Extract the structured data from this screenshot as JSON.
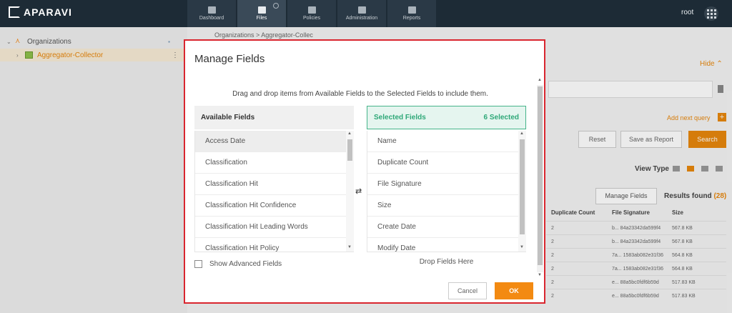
{
  "app": {
    "brand": "APARAVI",
    "user": "root"
  },
  "nav": [
    {
      "label": "Dashboard",
      "icon": "dashboard-icon"
    },
    {
      "label": "Files",
      "icon": "folder-icon"
    },
    {
      "label": "Policies",
      "icon": "gear-icon"
    },
    {
      "label": "Administration",
      "icon": "users-icon"
    },
    {
      "label": "Reports",
      "icon": "report-icon"
    }
  ],
  "sidebar": {
    "org_label": "Organizations",
    "collector_label": "Aggregator-Collector"
  },
  "background": {
    "breadcrumb": "Organizations  >  Aggregator-Collec",
    "hide_label": "Hide",
    "add_query_label": "Add next query",
    "reset_label": "Reset",
    "save_report_label": "Save as Report",
    "search_label": "Search",
    "view_type_label": "View Type",
    "manage_fields_label": "Manage Fields",
    "results_label": "Results found",
    "results_count": "(28)",
    "table": {
      "headers": [
        "Duplicate Count",
        "File Signature",
        "Size"
      ],
      "rows": [
        [
          "2",
          "b... 84a23342da599f4",
          "567.8 KB"
        ],
        [
          "2",
          "b... 84a23342da599f4",
          "567.8 KB"
        ],
        [
          "2",
          "7a... 1583ab082e31f36",
          "564.8 KB"
        ],
        [
          "2",
          "7a... 1583ab082e31f36",
          "564.8 KB"
        ],
        [
          "2",
          "e... 88a5bc0fdf6b59d",
          "517.83 KB"
        ],
        [
          "2",
          "e... 88a5bc0fdf6b59d",
          "517.83 KB"
        ]
      ]
    }
  },
  "modal": {
    "title": "Manage Fields",
    "instructions": "Drag and drop items from Available Fields to the Selected Fields to include them.",
    "available_title": "Available Fields",
    "available_items": [
      "Access Date",
      "Classification",
      "Classification Hit",
      "Classification Hit Confidence",
      "Classification Hit Leading Words",
      "Classification Hit Policy"
    ],
    "selected_title": "Selected Fields",
    "selected_count": "6 Selected",
    "selected_items": [
      "Name",
      "Duplicate Count",
      "File Signature",
      "Size",
      "Create Date",
      "Modify Date"
    ],
    "show_advanced_label": "Show Advanced Fields",
    "drop_hint": "Drop Fields Here",
    "cancel_label": "Cancel",
    "ok_label": "OK"
  },
  "colors": {
    "accent": "#f38a12",
    "selected_green": "#2ea878",
    "modal_border": "#d9262f",
    "nav_bg": "#1d2b36"
  }
}
